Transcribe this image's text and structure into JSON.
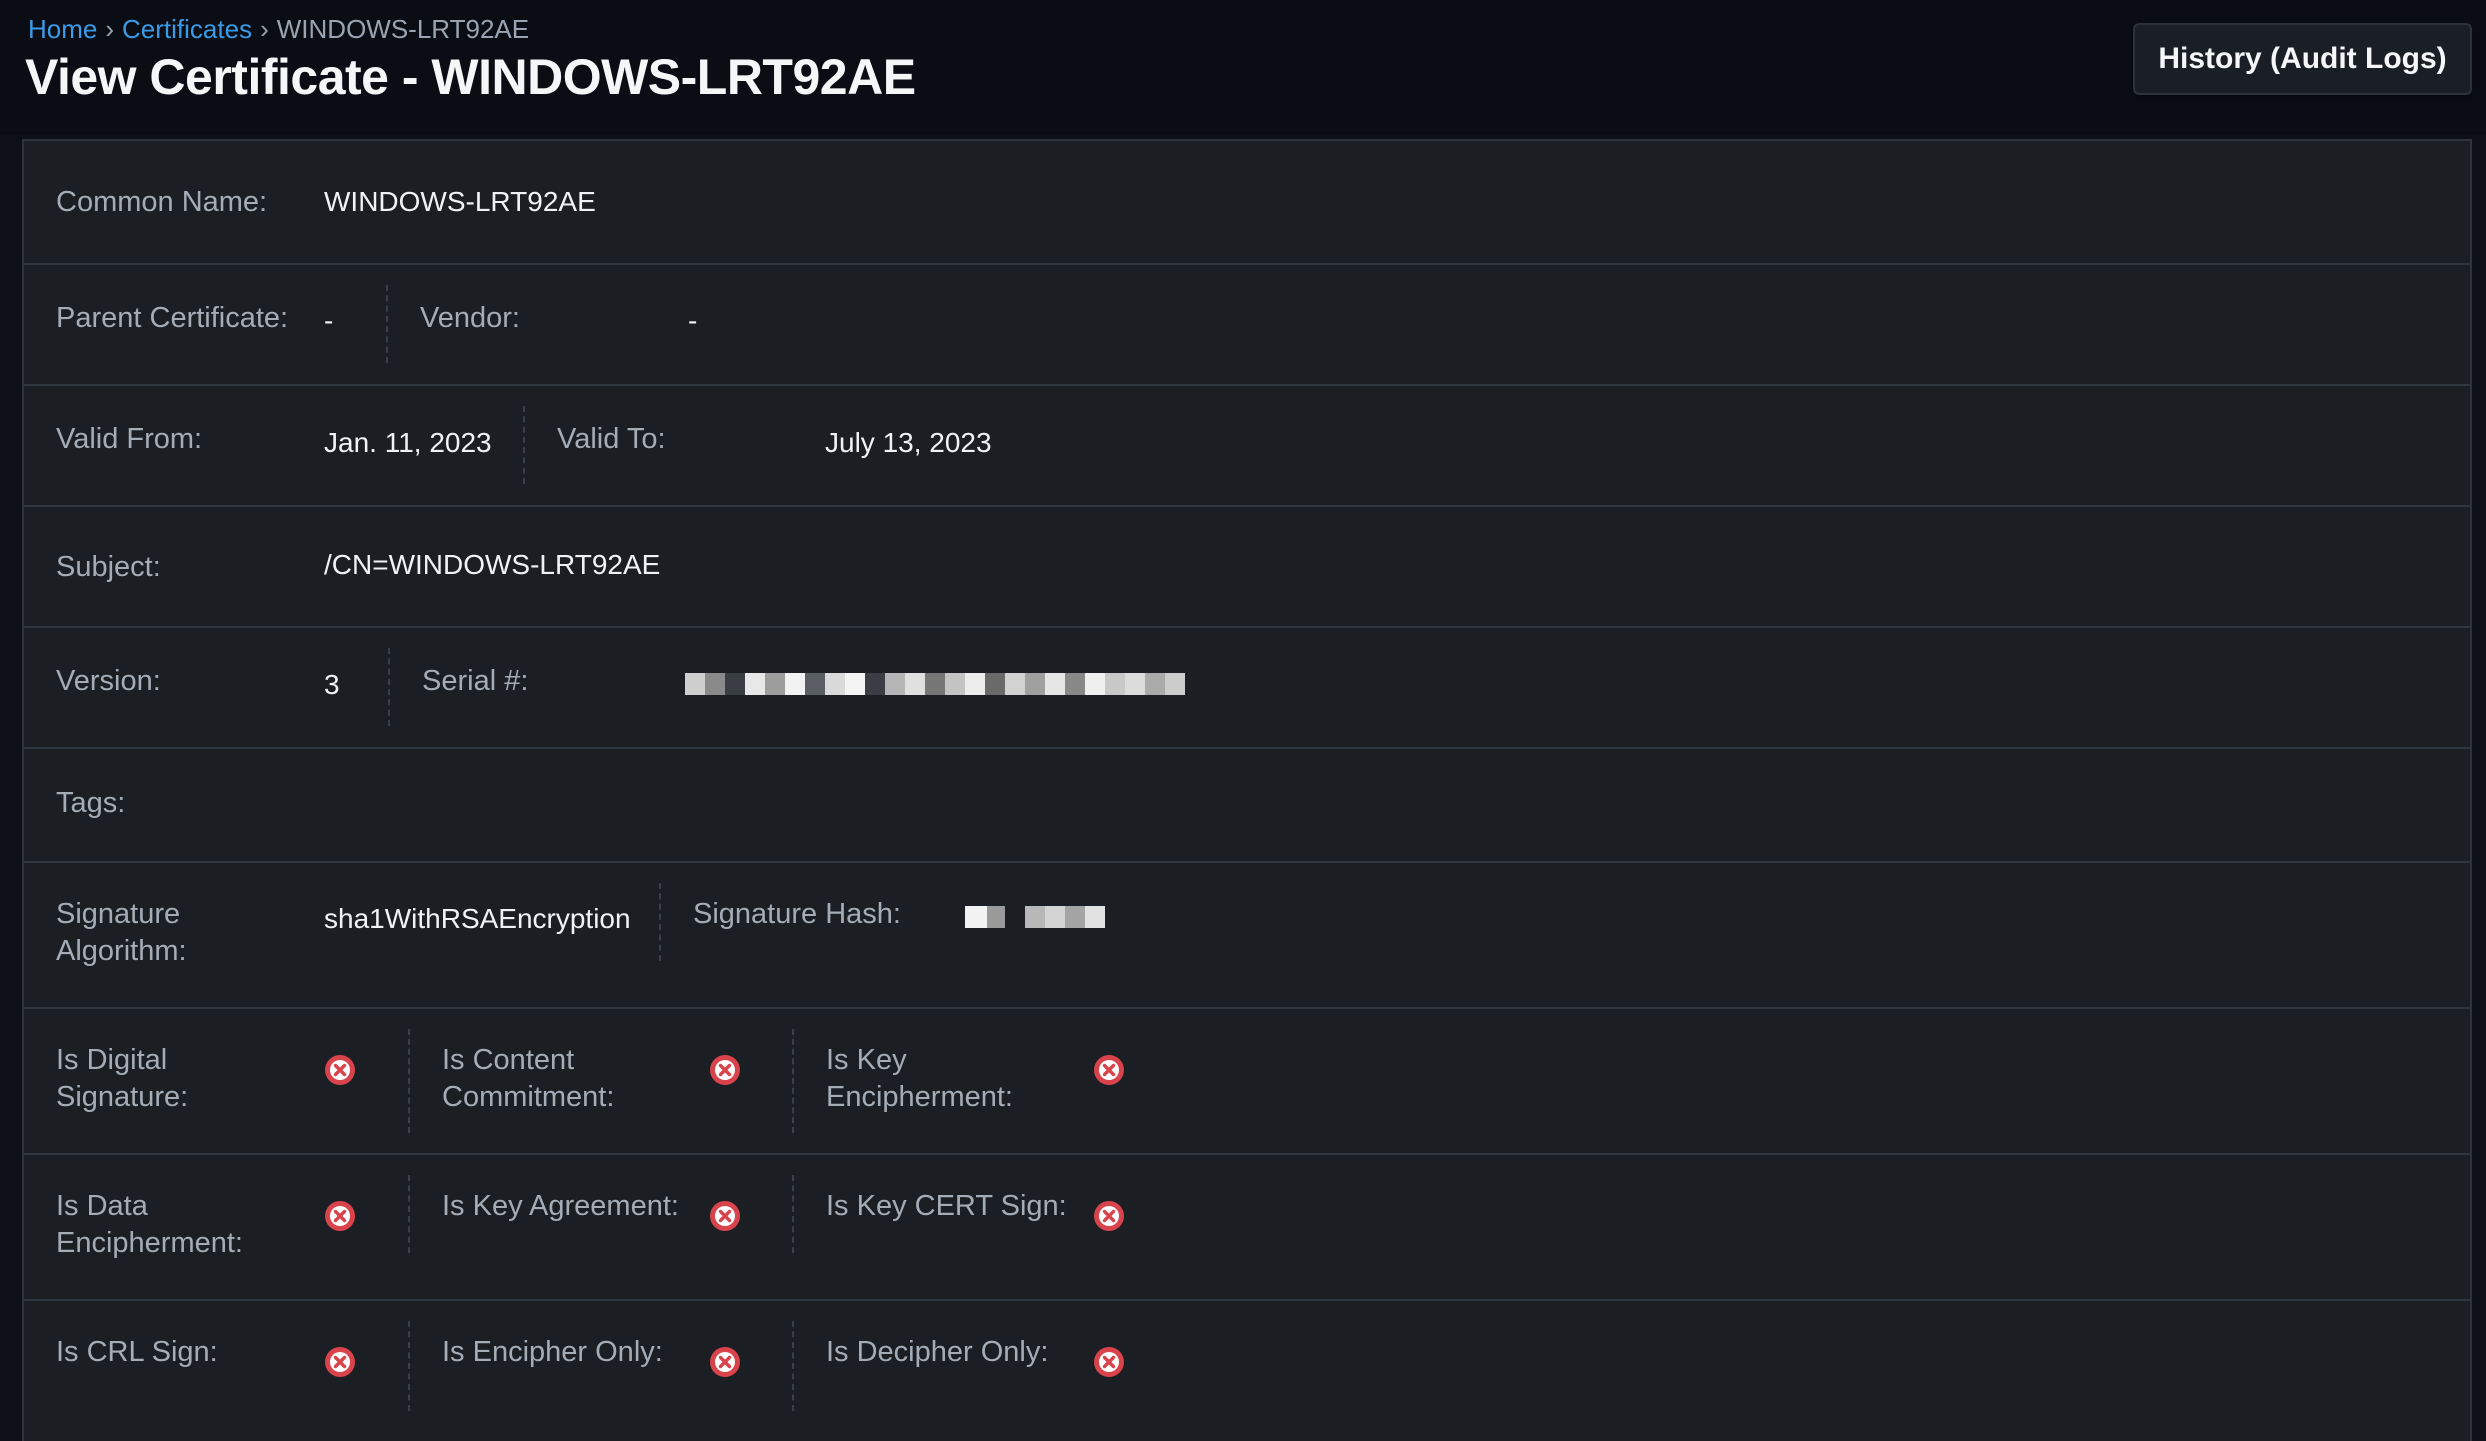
{
  "breadcrumb": {
    "home": "Home",
    "certificates": "Certificates",
    "current": "WINDOWS-LRT92AE",
    "separator": "›"
  },
  "page_title": "View Certificate - WINDOWS-LRT92AE",
  "history_button": "History (Audit Logs)",
  "fields": {
    "common_name": {
      "label": "Common Name:",
      "value": "WINDOWS-LRT92AE"
    },
    "parent_certificate": {
      "label": "Parent Certificate:",
      "value": "-"
    },
    "vendor": {
      "label": "Vendor:",
      "value": "-"
    },
    "valid_from": {
      "label": "Valid From:",
      "value": "Jan. 11, 2023"
    },
    "valid_to": {
      "label": "Valid To:",
      "value": "July 13, 2023"
    },
    "subject": {
      "label": "Subject:",
      "value": "/CN=WINDOWS-LRT92AE"
    },
    "version": {
      "label": "Version:",
      "value": "3"
    },
    "serial": {
      "label": "Serial #:",
      "value": ""
    },
    "tags": {
      "label": "Tags:",
      "value": ""
    },
    "signature_algorithm": {
      "label": "Signature Algorithm:",
      "value": "sha1WithRSAEncryption"
    },
    "signature_hash": {
      "label": "Signature Hash:",
      "value": ""
    }
  },
  "key_usage": [
    {
      "label": "Is Digital Signature:",
      "value": false,
      "icon": "x-circle-icon"
    },
    {
      "label": "Is Content Commitment:",
      "value": false,
      "icon": "x-circle-icon"
    },
    {
      "label": "Is Key Encipherment:",
      "value": false,
      "icon": "x-circle-icon"
    },
    {
      "label": "Is Data Encipherment:",
      "value": false,
      "icon": "x-circle-icon"
    },
    {
      "label": "Is Key Agreement:",
      "value": false,
      "icon": "x-circle-icon"
    },
    {
      "label": "Is Key CERT Sign:",
      "value": false,
      "icon": "x-circle-icon"
    },
    {
      "label": "Is CRL Sign:",
      "value": false,
      "icon": "x-circle-icon"
    },
    {
      "label": "Is Encipher Only:",
      "value": false,
      "icon": "x-circle-icon"
    },
    {
      "label": "Is Decipher Only:",
      "value": false,
      "icon": "x-circle-icon"
    }
  ],
  "colors": {
    "background": "#0d1117",
    "card": "#1b1f24",
    "link": "#3b9ae8",
    "false_icon": "#d9434b"
  }
}
